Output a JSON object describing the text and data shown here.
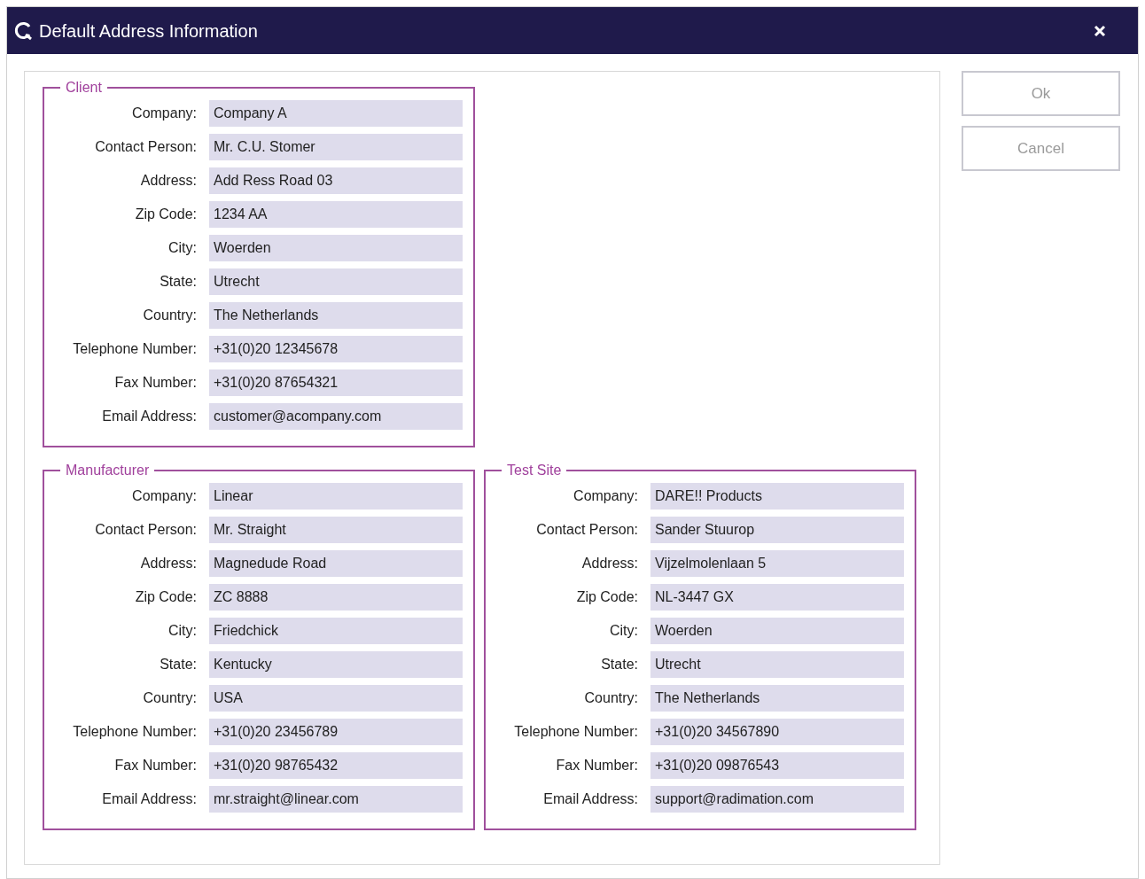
{
  "window": {
    "title": "Default Address Information"
  },
  "groups": [
    {
      "title": "Client",
      "fields": [
        {
          "label": "Company:",
          "value": "Company A"
        },
        {
          "label": "Contact Person:",
          "value": "Mr. C.U. Stomer"
        },
        {
          "label": "Address:",
          "value": "Add Ress Road 03"
        },
        {
          "label": "Zip Code:",
          "value": "1234 AA"
        },
        {
          "label": "City:",
          "value": "Woerden"
        },
        {
          "label": "State:",
          "value": "Utrecht"
        },
        {
          "label": "Country:",
          "value": "The Netherlands"
        },
        {
          "label": "Telephone Number:",
          "value": "+31(0)20 12345678"
        },
        {
          "label": "Fax Number:",
          "value": "+31(0)20 87654321"
        },
        {
          "label": "Email Address:",
          "value": "customer@acompany.com"
        }
      ]
    },
    {
      "title": "Manufacturer",
      "fields": [
        {
          "label": "Company:",
          "value": "Linear"
        },
        {
          "label": "Contact Person:",
          "value": "Mr. Straight"
        },
        {
          "label": "Address:",
          "value": "Magnedude Road"
        },
        {
          "label": "Zip Code:",
          "value": "ZC 8888"
        },
        {
          "label": "City:",
          "value": "Friedchick"
        },
        {
          "label": "State:",
          "value": "Kentucky"
        },
        {
          "label": "Country:",
          "value": "USA"
        },
        {
          "label": "Telephone Number:",
          "value": "+31(0)20 23456789"
        },
        {
          "label": "Fax Number:",
          "value": "+31(0)20 98765432"
        },
        {
          "label": "Email Address:",
          "value": "mr.straight@linear.com"
        }
      ]
    },
    {
      "title": "Test Site",
      "fields": [
        {
          "label": "Company:",
          "value": "DARE!! Products"
        },
        {
          "label": "Contact Person:",
          "value": "Sander Stuurop"
        },
        {
          "label": "Address:",
          "value": "Vijzelmolenlaan 5"
        },
        {
          "label": "Zip Code:",
          "value": "NL-3447 GX"
        },
        {
          "label": "City:",
          "value": "Woerden"
        },
        {
          "label": "State:",
          "value": "Utrecht"
        },
        {
          "label": "Country:",
          "value": "The Netherlands"
        },
        {
          "label": "Telephone Number:",
          "value": "+31(0)20 34567890"
        },
        {
          "label": "Fax Number:",
          "value": "+31(0)20 09876543"
        },
        {
          "label": "Email Address:",
          "value": "support@radimation.com"
        }
      ]
    }
  ],
  "buttons": [
    {
      "label": "Ok"
    },
    {
      "label": "Cancel"
    }
  ]
}
